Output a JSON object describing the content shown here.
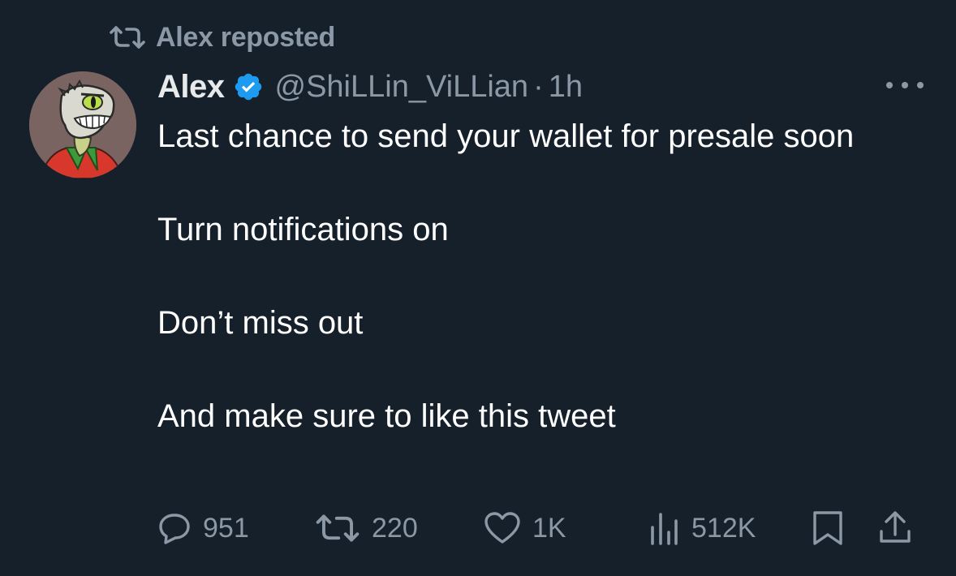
{
  "repost": {
    "icon": "repost-icon",
    "label": "Alex reposted"
  },
  "tweet": {
    "author": {
      "display_name": "Alex",
      "handle": "@ShiLLin_ViLLian",
      "verified": true,
      "avatar": "lizard-cartoon-avatar"
    },
    "separator": "·",
    "time": "1h",
    "more_icon": "more-options-icon",
    "lines": [
      "Last chance to send your wallet for presale soon",
      "Turn notifications on",
      "Don’t miss out",
      "And make sure to like this tweet"
    ]
  },
  "actions": {
    "reply": {
      "icon": "reply-icon",
      "count": "951"
    },
    "repost": {
      "icon": "repost-icon",
      "count": "220"
    },
    "like": {
      "icon": "heart-icon",
      "count": "1K"
    },
    "views": {
      "icon": "views-icon",
      "count": "512K"
    },
    "bookmark": {
      "icon": "bookmark-icon"
    },
    "share": {
      "icon": "share-icon"
    }
  },
  "colors": {
    "background": "#15202b",
    "text": "#ffffff",
    "muted": "#8b98a5",
    "verified": "#1d9bf0"
  }
}
